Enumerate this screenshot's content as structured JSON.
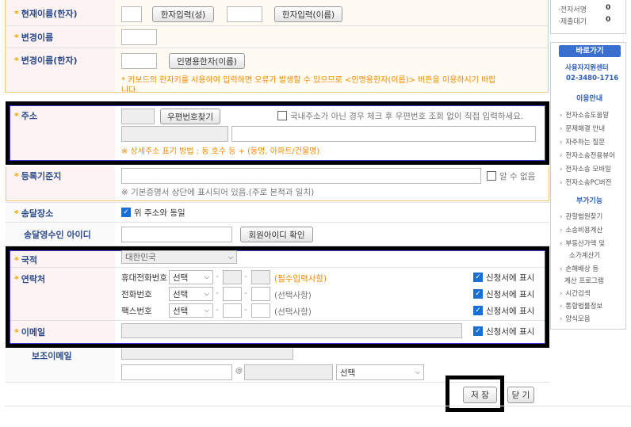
{
  "form": {
    "current_name_hanja": {
      "label": "현재이름(한자)",
      "surname_button": "한자입력(성)",
      "given_button": "한자입력(이름)"
    },
    "changed_name": {
      "label": "변경이름"
    },
    "changed_name_hanja": {
      "label": "변경이름(한자)",
      "button": "인명용한자(이름)",
      "warning_line1": "* 키보드의 한자키를 사용하여 입력하면 오류가 발생할 수 있으므로 <인명용한자(이름)> 버튼을 이용하시기 바랍",
      "warning_line2": "니다."
    },
    "address": {
      "label": "주소",
      "postcode_button": "우편번호찾기",
      "overseas_checkbox": "국내주소가 아닌 경우 체크 후 우편번호 조회 없이 직접 입력하세요.",
      "hint": "※ 상세주소 표기 방법 : 동 호수 등 + (동명, 아파트/건물명)"
    },
    "register_base": {
      "label": "등록기준지",
      "unknown_checkbox": "알 수 없음",
      "hint": "※ 기본증명서 상단에 표시되어 있음.(주로 본적과 일치)"
    },
    "delivery": {
      "label": "송달장소",
      "same_as_address": "위 주소와 동일"
    },
    "delivery_id": {
      "label": "송달영수인 아이디",
      "check_button": "회원아이디 확인"
    },
    "nationality": {
      "label": "국적",
      "value": "대한민국"
    },
    "contact": {
      "label": "연락처",
      "rows": [
        {
          "type": "휴대전화번호",
          "select": "선택",
          "note": "(필수입력사항)",
          "show": "신청서에 표시"
        },
        {
          "type": "전화번호",
          "select": "선택",
          "note": "(선택사항)",
          "show": "신청서에 표시"
        },
        {
          "type": "팩스번호",
          "select": "선택",
          "note": "(선택사항)",
          "show": "신청서에 표시"
        }
      ]
    },
    "email": {
      "label": "이메일",
      "show": "신청서에 표시"
    },
    "sub_email": {
      "label": "보조이메일",
      "at": "@",
      "domain_select": "선택"
    },
    "save_button": "저 장",
    "close_button": "닫 기"
  },
  "sidebar": {
    "stats": [
      {
        "label": "·전자서명",
        "value": "0"
      },
      {
        "label": "·제출대기",
        "value": "0"
      }
    ],
    "shortcut_title": "바로가기",
    "support_center": "사용자지원센터",
    "support_phone": "02-3480-1716",
    "usage_title": "이용안내",
    "usage_links": [
      "전자소송도움말",
      "문제해결 안내",
      "자주하는 질문",
      "전자소송전용뷰어",
      "전자소송 모바일",
      "전자소송PC버전"
    ],
    "extra_title": "부가기능",
    "extra_links": [
      "관할법원찾기",
      "소송비용계산",
      "부동산가액 및",
      "소가계산기",
      "손해배상 등",
      "계산 프로그램",
      "시간검색",
      "통합법률정보",
      "양식모음"
    ]
  },
  "colors": {
    "label_blue": "#2b4a8b",
    "star_orange": "#f0a500",
    "highlight_border": "#000000",
    "focus_blue": "#3a3ad6",
    "sidebar_button": "#3a6fd0"
  }
}
